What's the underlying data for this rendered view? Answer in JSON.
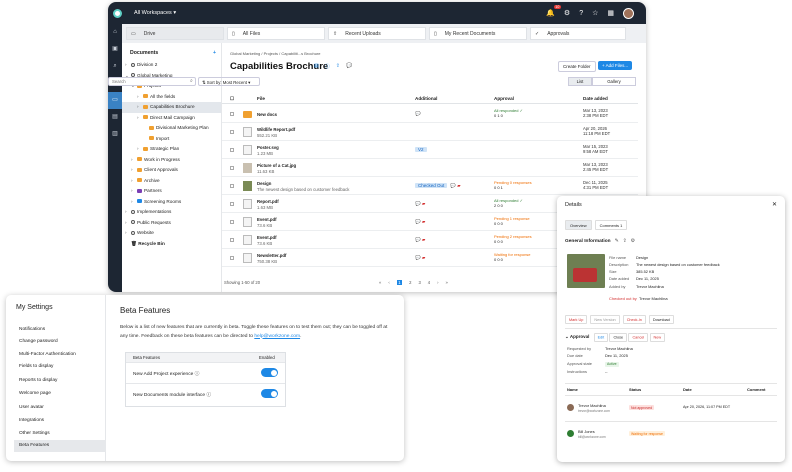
{
  "topbar": {
    "workspace": "All Workspaces",
    "notifications": "10"
  },
  "tabs": [
    {
      "label": "Drive"
    },
    {
      "label": "All Files"
    },
    {
      "label": "Recent Uploads"
    },
    {
      "label": "My Recent Documents"
    },
    {
      "label": "Approvals"
    }
  ],
  "sidebar": {
    "title": "Documents",
    "tree": [
      {
        "label": "Division 2"
      },
      {
        "label": "Global Marketing"
      },
      {
        "label": "Projects"
      },
      {
        "label": "All the fields"
      },
      {
        "label": "Capabilities Brochure"
      },
      {
        "label": "Direct Mail Campaign"
      },
      {
        "label": "Divisional Marketing Plan"
      },
      {
        "label": "Import"
      },
      {
        "label": "Strategic Plan"
      },
      {
        "label": "Work in Progress"
      },
      {
        "label": "Client Approvals"
      },
      {
        "label": "Archive"
      },
      {
        "label": "Partners"
      },
      {
        "label": "Screening Rooms"
      },
      {
        "label": "Implementations"
      },
      {
        "label": "Public Requests"
      },
      {
        "label": "Website"
      },
      {
        "label": "Recycle Bin"
      }
    ]
  },
  "main": {
    "breadcrumb": "Global Marketing  /  Projects  /  Capabiliti...s Brochure",
    "title": "Capabilities Brochure",
    "create_folder": "Create Folder",
    "add_files": "+ Add Files...",
    "search_placeholder": "Search",
    "sort": "Sort by: Most Recent",
    "view_list": "List",
    "view_gallery": "Gallery",
    "columns": {
      "file": "File",
      "additional": "Additional",
      "approval": "Approval",
      "date": "Date added"
    },
    "rows": [
      {
        "name": "New docs",
        "sub": "",
        "approval": "All responded",
        "counts": "0   1   0",
        "date": "Mar 13, 2023",
        "time": "2:38 PM EDT"
      },
      {
        "name": "Wildlife Report.pdf",
        "sub": "552.21 KB",
        "approval": "",
        "counts": "",
        "date": "Apr 20, 2026",
        "time": "11:18 PM EDT"
      },
      {
        "name": "Poster.svg",
        "sub": "1.23 MB",
        "chip": "V2",
        "approval": "",
        "counts": "",
        "date": "Mar 15, 2023",
        "time": "9:58 AM EDT"
      },
      {
        "name": "Picture of a Cat.jpg",
        "sub": "11.63 KB",
        "approval": "",
        "counts": "",
        "date": "Mar 13, 2023",
        "time": "2:45 PM EDT"
      },
      {
        "name": "Design",
        "sub": "The newest design based on customer feedback",
        "chip": "Checked Out",
        "approval": "Pending 0 responses",
        "counts": "0   0   1",
        "date": "Dec 11, 2025",
        "time": "4:31 PM EDT"
      },
      {
        "name": "Report.pdf",
        "sub": "1.63 MB",
        "approval": "All responded",
        "counts": "2   0   0",
        "date": "Apr 20, 2026",
        "time": "11:08 PM EDT"
      },
      {
        "name": "Event.pdf",
        "sub": "73.6 KB",
        "approval": "Pending 1 response",
        "counts": "0   0   0",
        "date": "Apr 20, 2026",
        "time": "11:08 PM EDT"
      },
      {
        "name": "Event.pdf",
        "sub": "73.6 KB",
        "approval": "Pending 2 responses",
        "counts": "0   0   0",
        "date": "Apr 20, 2026",
        "time": "11:08 PM EDT"
      },
      {
        "name": "Newsletter.pdf",
        "sub": "750.38 KB",
        "approval": "Waiting for response",
        "counts": "0   0   0",
        "date": "Apr 20, 2026",
        "time": "11:08 PM EDT"
      }
    ],
    "pager_label": "Showing 1-50 of 20",
    "pages": [
      "«",
      "‹",
      "1",
      "2",
      "3",
      "4",
      "›",
      "»"
    ]
  },
  "details": {
    "title": "Details",
    "tab_overview": "Overview",
    "tab_comments": "Comments",
    "comments_count": "1",
    "general": "General Information",
    "file_name_k": "File name",
    "file_name_v": "Design",
    "desc_k": "Description",
    "desc_v": "The newest design based on customer feedback",
    "size_k": "Size",
    "size_v": "385.52 KB",
    "date_k": "Date added",
    "date_v": "Dec 11, 2025",
    "added_k": "Added by",
    "added_v": "Trevor Machlina",
    "checked": "Checked out by",
    "checked_v": "Trevor Machlina",
    "btn_markup": "Mark Up",
    "btn_newver": "New Version",
    "btn_checkin": "Check-In",
    "btn_download": "Download",
    "approval": "Approval",
    "ap_edit": "Edit",
    "ap_close": "Close",
    "ap_cancel": "Cancel",
    "ap_new": "New",
    "req_k": "Requested by",
    "req_v": "Trevor Machlina",
    "due_k": "Due date",
    "due_v": "Dec 11, 2025",
    "state_k": "Approval state",
    "state_v": "Active",
    "instr_k": "Instructions",
    "instr_v": "--",
    "col_name": "Name",
    "col_status": "Status",
    "col_date": "Date",
    "col_comment": "Comment",
    "people": [
      {
        "name": "Trevor Machlina",
        "email": "trevor@workzone.com",
        "status": "Not approved",
        "date": "Apr 20, 2026, 11:07 PM EDT"
      },
      {
        "name": "Bill Jones",
        "email": "bill@workzone.com",
        "status": "Waiting for response",
        "date": ""
      }
    ]
  },
  "settings": {
    "title": "My Settings",
    "items": [
      "Notifications",
      "Change password",
      "Multi-Factor Authentication",
      "Fields to display",
      "Reports to display",
      "Welcome page",
      "User avatar",
      "Integrations",
      "Other Settings",
      "Beta Features"
    ],
    "heading": "Beta Features",
    "para": "Below is a list of new features that are currently in beta. Toggle these features on to test them out; they can be toggled off at any time. Feedback on these beta features can be directed to ",
    "link": "help@workzone.com",
    "para_end": ".",
    "col_feature": "Beta Features",
    "col_enabled": "Enabled",
    "features": [
      "New Add Project experience",
      "New Documents module interface"
    ]
  }
}
